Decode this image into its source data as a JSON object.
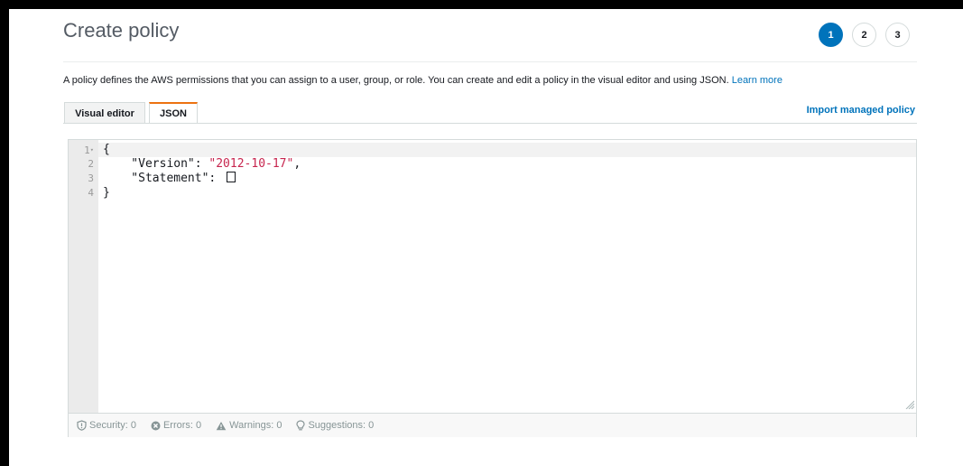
{
  "header": {
    "title": "Create policy",
    "steps": [
      "1",
      "2",
      "3"
    ],
    "active_step": "1"
  },
  "description": {
    "text": "A policy defines the AWS permissions that you can assign to a user, group, or role. You can create and edit a policy in the visual editor and using JSON.",
    "link": "Learn more"
  },
  "tabs": [
    {
      "label": "Visual editor",
      "active": false
    },
    {
      "label": "JSON",
      "active": true
    }
  ],
  "import_link": "Import managed policy",
  "editor": {
    "line_numbers": [
      "1",
      "2",
      "3",
      "4"
    ],
    "lines": {
      "l1": "{",
      "l2_key": "    \"Version\": ",
      "l2_val": "\"2012-10-17\"",
      "l2_tail": ",",
      "l3_key": "    \"Statement\": ",
      "l4": "}"
    }
  },
  "status": {
    "security": "Security: 0",
    "errors": "Errors: 0",
    "warnings": "Warnings: 0",
    "suggestions": "Suggestions: 0"
  },
  "colors": {
    "accent": "#0073bb",
    "tab_active": "#ec7211",
    "string": "#c7254e"
  }
}
